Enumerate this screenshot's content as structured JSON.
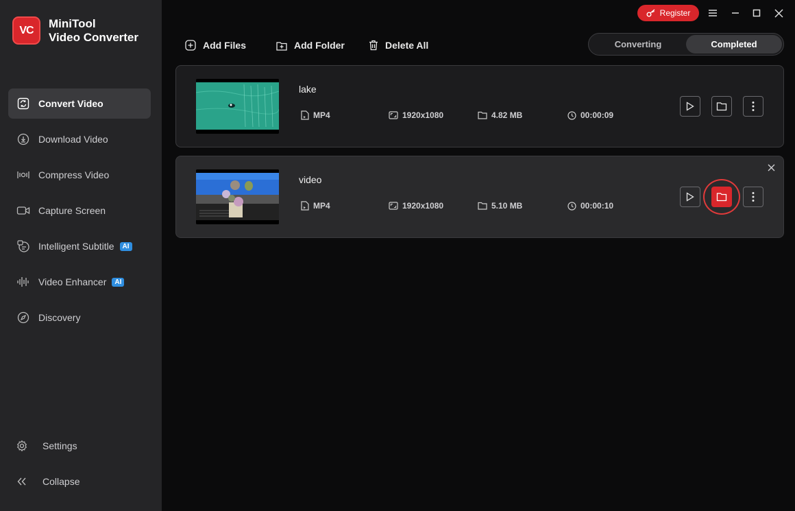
{
  "app": {
    "logo_text": "VC",
    "name_line1": "MiniTool",
    "name_line2": "Video Converter"
  },
  "sidebar": {
    "items": [
      {
        "label": "Convert Video",
        "icon": "convert-icon",
        "active": true
      },
      {
        "label": "Download Video",
        "icon": "download-icon",
        "active": false
      },
      {
        "label": "Compress Video",
        "icon": "compress-icon",
        "active": false
      },
      {
        "label": "Capture Screen",
        "icon": "camera-icon",
        "active": false
      },
      {
        "label": "Intelligent Subtitle",
        "icon": "subtitle-icon",
        "badge": "AI",
        "active": false
      },
      {
        "label": "Video Enhancer",
        "icon": "enhancer-icon",
        "badge": "AI",
        "active": false
      },
      {
        "label": "Discovery",
        "icon": "compass-icon",
        "active": false
      }
    ],
    "settings_label": "Settings",
    "collapse_label": "Collapse"
  },
  "titlebar": {
    "register_label": "Register"
  },
  "toolbar": {
    "add_files": "Add Files",
    "add_folder": "Add Folder",
    "delete_all": "Delete All"
  },
  "tabs": {
    "converting": "Converting",
    "completed": "Completed",
    "active": "Completed"
  },
  "files": [
    {
      "name": "lake",
      "format": "MP4",
      "resolution": "1920x1080",
      "size": "4.82 MB",
      "duration": "00:00:09"
    },
    {
      "name": "video",
      "format": "MP4",
      "resolution": "1920x1080",
      "size": "5.10 MB",
      "duration": "00:00:10"
    }
  ],
  "colors": {
    "accent": "#d9262b",
    "sidebar_bg": "#252527",
    "main_bg": "#0b0b0c",
    "ai_badge": "#2f8ee0"
  }
}
